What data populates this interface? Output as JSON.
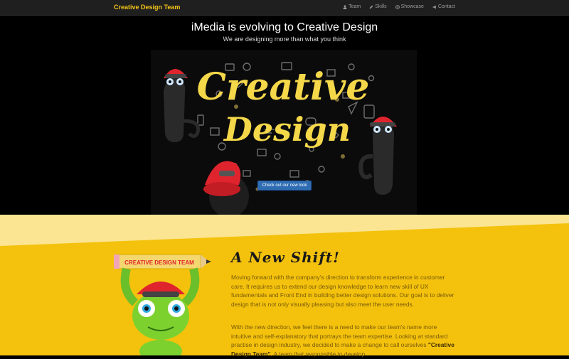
{
  "navbar": {
    "brand": "Creative Design Team",
    "links": [
      {
        "label": "Team",
        "icon": "user-icon"
      },
      {
        "label": "Skills",
        "icon": "pencil-icon"
      },
      {
        "label": "Showcase",
        "icon": "globe-icon"
      },
      {
        "label": "Contact",
        "icon": "megaphone-icon"
      }
    ]
  },
  "hero": {
    "title": "iMedia is evolving to Creative Design",
    "subtitle": "We are designing more than what you think",
    "artwork": {
      "line1": "Creative",
      "line2": "Design"
    },
    "cta_label": "Check out our new look"
  },
  "shift": {
    "title": "A New Shift!",
    "banner": "CREATIVE DESIGN TEAM",
    "paragraph1": "Moving forward with the company's direction to transform experience in customer care. It requires us to extend our design knowledge to learn new skill of UX fundamentals and Front End in building better design solutions. Our goal is to deliver design that is not only visually pleasing but also meet the user needs.",
    "paragraph2_before": "With the new direction, we feel there is a need to make our team's name more intuitive and self-explanatory that portrays the team expertise. Looking at standard practise in design industry, we decided to make a change to call ourselves ",
    "paragraph2_bold": "\"Creative Design Team\"",
    "paragraph2_after": ". A team that responsible to develop"
  },
  "colors": {
    "accent": "#f5c518",
    "cta": "#2f6db3",
    "yellow_bg": "#f4c20d"
  }
}
